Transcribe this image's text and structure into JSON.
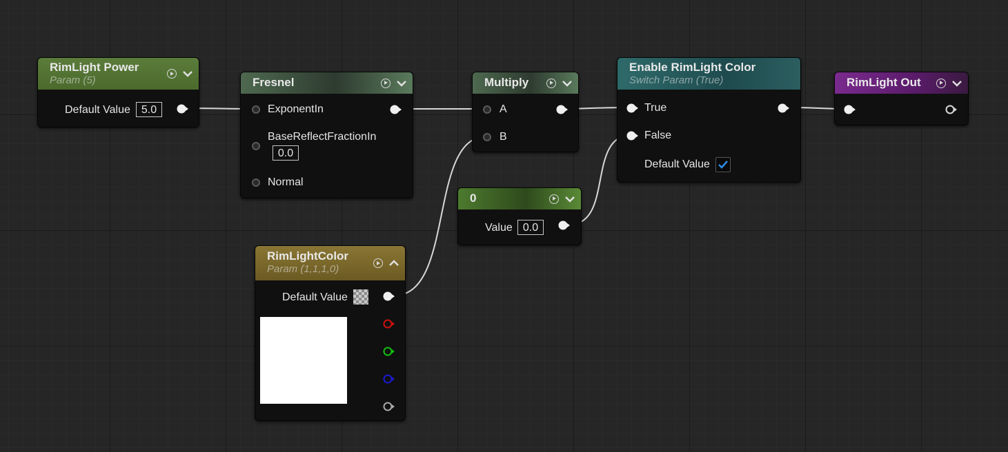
{
  "nodes": {
    "rimlight_power": {
      "title": "RimLight Power",
      "subtitle": "Param (5)",
      "default_label": "Default Value",
      "default_value": "5.0"
    },
    "fresnel": {
      "title": "Fresnel",
      "inputs": [
        "ExponentIn",
        "BaseReflectFractionIn",
        "Normal"
      ],
      "base_reflect_value": "0.0"
    },
    "multiply": {
      "title": "Multiply",
      "inputs": [
        "A",
        "B"
      ]
    },
    "constant": {
      "title": "0",
      "value_label": "Value",
      "value": "0.0"
    },
    "enable_rimlight_color": {
      "title": "Enable RimLight Color",
      "subtitle": "Switch Param (True)",
      "inputs": [
        "True",
        "False"
      ],
      "default_label": "Default Value",
      "default_checked": true
    },
    "rimlight_out": {
      "title": "RimLight Out"
    },
    "rimlight_color": {
      "title": "RimLightColor",
      "subtitle": "Param (1,1,1,0)",
      "default_label": "Default Value",
      "swatch_color": "#ffffff"
    }
  },
  "pin_colors": {
    "red": "#d01010",
    "green": "#10c010",
    "blue": "#1a1ad0",
    "alpha": "#aaaaaa"
  },
  "icons": {
    "expand": "play-circle-icon",
    "collapse": "chevron-down-icon",
    "expand_up": "chevron-up-icon"
  }
}
